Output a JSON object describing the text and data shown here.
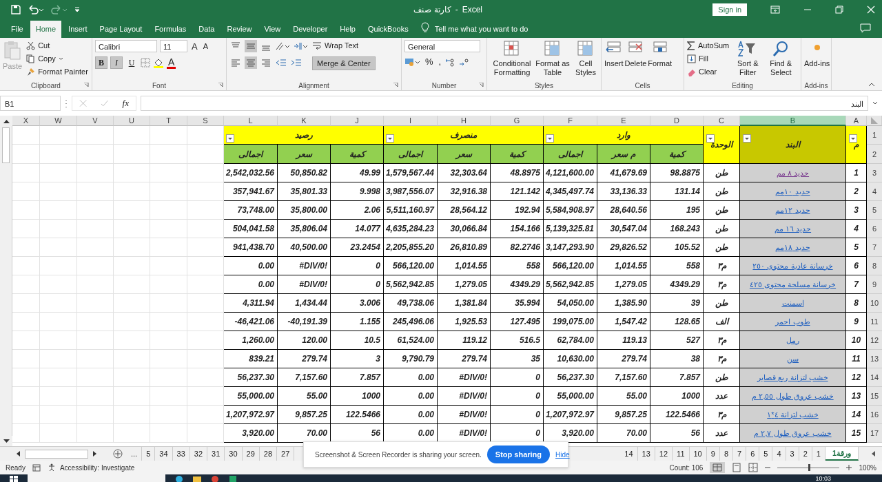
{
  "window": {
    "title": "كارتة صنف",
    "separator": "-",
    "app": "Excel",
    "sign_in": "Sign in"
  },
  "ribbon_tabs": [
    {
      "label": "File",
      "selected": false
    },
    {
      "label": "Home",
      "selected": true
    },
    {
      "label": "Insert",
      "selected": false
    },
    {
      "label": "Page Layout",
      "selected": false
    },
    {
      "label": "Formulas",
      "selected": false
    },
    {
      "label": "Data",
      "selected": false
    },
    {
      "label": "Review",
      "selected": false
    },
    {
      "label": "View",
      "selected": false
    },
    {
      "label": "Developer",
      "selected": false
    },
    {
      "label": "Help",
      "selected": false
    },
    {
      "label": "QuickBooks",
      "selected": false
    }
  ],
  "tell_me": "Tell me what you want to do",
  "ribbon": {
    "clipboard": {
      "label": "Clipboard",
      "paste": "Paste",
      "cut": "Cut",
      "copy": "Copy",
      "format_painter": "Format Painter"
    },
    "font": {
      "label": "Font",
      "name": "Calibri",
      "size": "11",
      "grow": "A",
      "shrink": "A",
      "font_color": "A",
      "bold": {
        "label": "B",
        "on": true
      },
      "italic": {
        "label": "I",
        "on": true
      },
      "underline": {
        "label": "U",
        "on": false
      }
    },
    "alignment": {
      "label": "Alignment",
      "wrap": "Wrap Text",
      "merge": {
        "label": "Merge & Center",
        "on": true
      }
    },
    "number": {
      "label": "Number",
      "format": "General",
      "percent": "%",
      "comma": ","
    },
    "styles": {
      "label": "Styles",
      "items": [
        "Conditional Formatting",
        "Format as Table",
        "Cell Styles"
      ]
    },
    "cells": {
      "label": "Cells",
      "items": [
        "Insert",
        "Delete",
        "Format"
      ]
    },
    "editing": {
      "label": "Editing",
      "autosum": "AutoSum",
      "fill": "Fill",
      "clear": "Clear",
      "sort": "Sort & Filter",
      "find": "Find & Select"
    },
    "addins": {
      "label": "Add-ins",
      "button": "Add-ins"
    }
  },
  "formula_bar": {
    "name_box": "B1",
    "fx": "fx",
    "value": "البند"
  },
  "sheet": {
    "columns": [
      {
        "label": "X",
        "selected": false
      },
      {
        "label": "W",
        "selected": false
      },
      {
        "label": "V",
        "selected": false
      },
      {
        "label": "U",
        "selected": false
      },
      {
        "label": "T",
        "selected": false
      },
      {
        "label": "S",
        "selected": false
      },
      {
        "label": "L",
        "selected": false
      },
      {
        "label": "K",
        "selected": false
      },
      {
        "label": "J",
        "selected": false
      },
      {
        "label": "I",
        "selected": false
      },
      {
        "label": "H",
        "selected": false
      },
      {
        "label": "G",
        "selected": false
      },
      {
        "label": "F",
        "selected": false
      },
      {
        "label": "E",
        "selected": false
      },
      {
        "label": "D",
        "selected": false
      },
      {
        "label": "C",
        "selected": false
      },
      {
        "label": "B",
        "selected": true
      },
      {
        "label": "A",
        "selected": false
      }
    ],
    "row_numbers": [
      "1",
      "2",
      "3",
      "4",
      "5",
      "6",
      "7",
      "8",
      "9",
      "10",
      "11",
      "12",
      "13",
      "14",
      "15",
      "16",
      "17"
    ],
    "header": {
      "groups": [
        "وارد",
        "منصرف",
        "رصيد"
      ],
      "unit": "الوحدة",
      "item": "البند",
      "num": "م",
      "sub": [
        "كمية",
        "م سعر",
        "اجمالى",
        "كمية",
        "سعر",
        "اجمالى",
        "كمية",
        "سعر",
        "اجمالى"
      ]
    },
    "rows": [
      {
        "num": "1",
        "item": "حديد ٨ مم",
        "unit": "طن",
        "visited": true,
        "values": [
          "2,542,032.56",
          "50,850.82",
          "49.99",
          "1,579,567.44",
          "32,303.64",
          "48.8975",
          "4,121,600.00",
          "41,679.69",
          "98.8875"
        ]
      },
      {
        "num": "2",
        "item": "حديد ١٠مم",
        "unit": "طن",
        "visited": false,
        "values": [
          "357,941.67",
          "35,801.33",
          "9.998",
          "3,987,556.07",
          "32,916.38",
          "121.142",
          "4,345,497.74",
          "33,136.33",
          "131.14"
        ]
      },
      {
        "num": "3",
        "item": "حديد ١٢مم",
        "unit": "طن",
        "visited": false,
        "values": [
          "73,748.00",
          "35,800.00",
          "2.06",
          "5,511,160.97",
          "28,564.12",
          "192.94",
          "5,584,908.97",
          "28,640.56",
          "195"
        ]
      },
      {
        "num": "4",
        "item": "حديد ١٦ مم",
        "unit": "طن",
        "visited": false,
        "values": [
          "504,041.58",
          "35,806.04",
          "14.077",
          "4,635,284.23",
          "30,066.84",
          "154.166",
          "5,139,325.81",
          "30,547.04",
          "168.243"
        ]
      },
      {
        "num": "5",
        "item": "حديد ١٨مم",
        "unit": "طن",
        "visited": false,
        "values": [
          "941,438.70",
          "40,500.00",
          "23.2454",
          "2,205,855.20",
          "26,810.89",
          "82.2746",
          "3,147,293.90",
          "29,826.52",
          "105.52"
        ]
      },
      {
        "num": "6",
        "item": "خرسانة عادية محتوى ٢٥٠",
        "unit": "م٣",
        "visited": false,
        "values": [
          "0.00",
          "#DIV/0!",
          "0",
          "566,120.00",
          "1,014.55",
          "558",
          "566,120.00",
          "1,014.55",
          "558"
        ]
      },
      {
        "num": "7",
        "item": "خرسانة مسلحة محتوى ٤٢٥",
        "unit": "م٣",
        "visited": false,
        "values": [
          "0.00",
          "#DIV/0!",
          "0",
          "5,562,942.85",
          "1,279.05",
          "4349.29",
          "5,562,942.85",
          "1,279.05",
          "4349.29"
        ]
      },
      {
        "num": "8",
        "item": "اسمنت",
        "unit": "طن",
        "visited": false,
        "values": [
          "4,311.94",
          "1,434.44",
          "3.006",
          "49,738.06",
          "1,381.84",
          "35.994",
          "54,050.00",
          "1,385.90",
          "39"
        ]
      },
      {
        "num": "9",
        "item": "طوب احمر",
        "unit": "الف",
        "visited": false,
        "values": [
          "-46,421.06",
          "-40,191.39",
          "1.155",
          "245,496.06",
          "1,925.53",
          "127.495",
          "199,075.00",
          "1,547.42",
          "128.65"
        ]
      },
      {
        "num": "10",
        "item": "رمل",
        "unit": "م٣",
        "visited": false,
        "values": [
          "1,260.00",
          "120.00",
          "10.5",
          "61,524.00",
          "119.12",
          "516.5",
          "62,784.00",
          "119.13",
          "527"
        ]
      },
      {
        "num": "11",
        "item": "سن",
        "unit": "م٣",
        "visited": false,
        "values": [
          "839.21",
          "279.74",
          "3",
          "9,790.79",
          "279.74",
          "35",
          "10,630.00",
          "279.74",
          "38"
        ]
      },
      {
        "num": "12",
        "item": "خشب لتزانة ربع قصاير",
        "unit": "طن",
        "visited": false,
        "values": [
          "56,237.30",
          "7,157.60",
          "7.857",
          "0.00",
          "#DIV/0!",
          "0",
          "56,237.30",
          "7,157.60",
          "7.857"
        ]
      },
      {
        "num": "13",
        "item": "خشب عروق طول ٢,٥٥ م",
        "unit": "عدد",
        "visited": false,
        "values": [
          "55,000.00",
          "55.00",
          "1000",
          "0.00",
          "#DIV/0!",
          "0",
          "55,000.00",
          "55.00",
          "1000"
        ]
      },
      {
        "num": "14",
        "item": "خشب لتزانة ٤*١",
        "unit": "م٣",
        "visited": false,
        "values": [
          "1,207,972.97",
          "9,857.25",
          "122.5466",
          "0.00",
          "#DIV/0!",
          "0",
          "1,207,972.97",
          "9,857.25",
          "122.5466"
        ]
      },
      {
        "num": "15",
        "item": "خشب عروق طول ٢,٧ م",
        "unit": "عدد",
        "visited": false,
        "values": [
          "3,920.00",
          "70.00",
          "56",
          "0.00",
          "#DIV/0!",
          "0",
          "3,920.00",
          "70.00",
          "56"
        ]
      }
    ]
  },
  "sheet_tabs_left": [
    {
      "label": "...",
      "selected": false
    },
    {
      "label": "5",
      "selected": false
    },
    {
      "label": "34",
      "selected": false
    },
    {
      "label": "33",
      "selected": false
    },
    {
      "label": "32",
      "selected": false
    },
    {
      "label": "31",
      "selected": false
    },
    {
      "label": "30",
      "selected": false
    },
    {
      "label": "29",
      "selected": false
    },
    {
      "label": "28",
      "selected": false
    },
    {
      "label": "27",
      "selected": false
    }
  ],
  "sheet_tabs_right": [
    {
      "label": "14",
      "selected": false
    },
    {
      "label": "13",
      "selected": false
    },
    {
      "label": "12",
      "selected": false
    },
    {
      "label": "11",
      "selected": false
    },
    {
      "label": "10",
      "selected": false
    },
    {
      "label": "9",
      "selected": false
    },
    {
      "label": "8",
      "selected": false
    },
    {
      "label": "7",
      "selected": false
    },
    {
      "label": "6",
      "selected": false
    },
    {
      "label": "5",
      "selected": false
    },
    {
      "label": "4",
      "selected": false
    },
    {
      "label": "3",
      "selected": false
    },
    {
      "label": "2",
      "selected": false
    },
    {
      "label": "1",
      "selected": false
    },
    {
      "label": "ورقة1",
      "selected": true
    }
  ],
  "sharing_popup": {
    "message": "Screenshot & Screen Recorder is sharing your screen.",
    "stop": "Stop sharing",
    "hide": "Hide"
  },
  "status_bar": {
    "ready": "Ready",
    "accessibility": "Accessibility: Investigate",
    "count": "Count: 106",
    "zoom": "100%",
    "zoom_slider": {
      "level": 0.5
    }
  },
  "taskbar": {
    "time": "10:03"
  }
}
